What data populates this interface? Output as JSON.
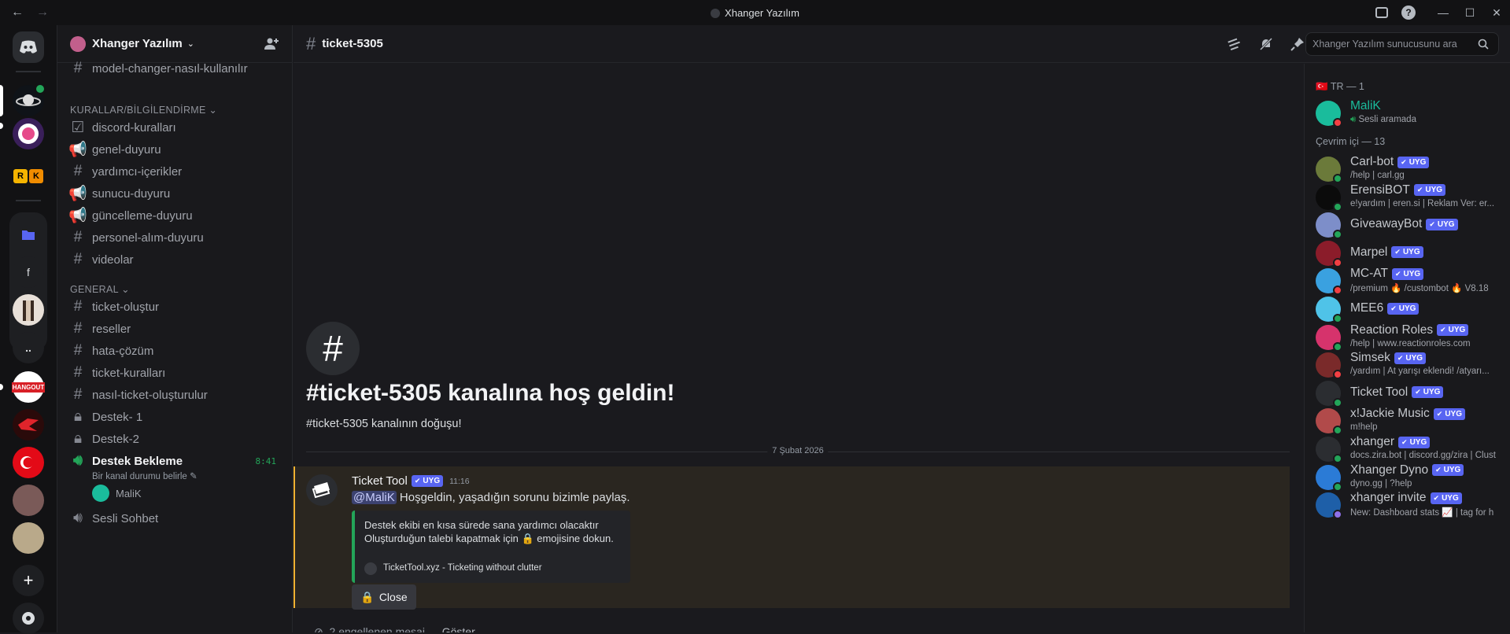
{
  "window": {
    "title": "Xhanger Yazılım"
  },
  "guild": {
    "name": "Xhanger Yazılım"
  },
  "sidebar": {
    "partial_channel": "model-changer-nasıl-kullanılır",
    "category1": "KURALLAR/BİLGİLENDİRME",
    "cat1_channels": [
      "discord-kuralları",
      "genel-duyuru",
      "yardımcı-içerikler",
      "sunucu-duyuru",
      "güncelleme-duyuru",
      "personel-alım-duyuru",
      "videolar"
    ],
    "category2": "GENERAL",
    "cat2_channels": [
      "ticket-oluştur",
      "reseller",
      "hata-çözüm",
      "ticket-kuralları",
      "nasıl-ticket-oluşturulur",
      "Destek- 1",
      "Destek-2"
    ],
    "voice_active": {
      "name": "Destek Bekleme",
      "time": "8:41",
      "status": "Bir kanal durumu belirle",
      "user": "MaliK"
    },
    "voice2": "Sesli Sohbet"
  },
  "rail": {
    "servers": [
      "f",
      ".."
    ],
    "hangout": "HANGOUT"
  },
  "header": {
    "channel": "ticket-5305",
    "search_placeholder": "Xhanger Yazılım sunucusunu ara"
  },
  "chat": {
    "welcome_icon": "#",
    "welcome_title": "#ticket-5305 kanalına hoş geldin!",
    "welcome_sub": "#ticket-5305 kanalının doğuşu!",
    "date_divider": "7 Şubat 2026",
    "message": {
      "author": "Ticket Tool",
      "tag": "UYG",
      "time": "11:16",
      "mention": "@MaliK",
      "text": " Hoşgeldin, yaşadığın sorunu bizimle paylaş.",
      "embed_line1": "Destek ekibi en kısa sürede sana yardımcı olacaktır",
      "embed_line2_a": "Oluşturduğun talebi kapatmak için ",
      "embed_line2_b": " emojisine dokun.",
      "embed_footer": "TicketTool.xyz - Ticketing without clutter",
      "button": "Close"
    },
    "blocked_text": "2 engellenen mesaj — ",
    "blocked_show": "Göster"
  },
  "members": {
    "group1": "TR — 1",
    "group2": "Çevrim içi — 13",
    "list1": [
      {
        "name": "MaliK",
        "status": "Sesli aramada",
        "color": "#1abc9c"
      }
    ],
    "list2": [
      {
        "name": "Carl-bot",
        "tag": "UYG",
        "status": "/help | carl.gg",
        "avc": "#6b7a3a"
      },
      {
        "name": "ErensiBOT",
        "tag": "UYG",
        "status": "e!yardım | eren.si | Reklam Ver: er...",
        "avc": "#0b0b0b"
      },
      {
        "name": "GiveawayBot",
        "tag": "UYG",
        "status": "",
        "avc": "#7d8ec9"
      },
      {
        "name": "Marpel",
        "tag": "UYG",
        "status": "",
        "avc": "#8b1c2a"
      },
      {
        "name": "MC-AT",
        "tag": "UYG",
        "status": "/premium 🔥 /custombot 🔥 V8.18",
        "avc": "#3aa1e0"
      },
      {
        "name": "MEE6",
        "tag": "UYG",
        "status": "",
        "avc": "#4fc3e8"
      },
      {
        "name": "Reaction Roles",
        "tag": "UYG",
        "status": "/help | www.reactionroles.com",
        "avc": "#d6336c"
      },
      {
        "name": "Simsek",
        "tag": "UYG",
        "status": "/yardım | At yarışı eklendi! /atyarı...",
        "avc": "#7a2a2a"
      },
      {
        "name": "Ticket Tool",
        "tag": "UYG",
        "status": "",
        "avc": "#2b2d31"
      },
      {
        "name": "x!Jackie Music",
        "tag": "UYG",
        "status": "m!help",
        "avc": "#b14a4a"
      },
      {
        "name": "xhanger",
        "tag": "UYG",
        "status": "docs.zira.bot | discord.gg/zira | Clust",
        "avc": "#2b2d31"
      },
      {
        "name": "Xhanger Dyno",
        "tag": "UYG",
        "status": "dyno.gg | ?help",
        "avc": "#2b7bd6"
      },
      {
        "name": "xhanger invite",
        "tag": "UYG",
        "status": "New: Dashboard stats 📈 | tag for h",
        "avc": "#1e5fa8"
      }
    ]
  }
}
